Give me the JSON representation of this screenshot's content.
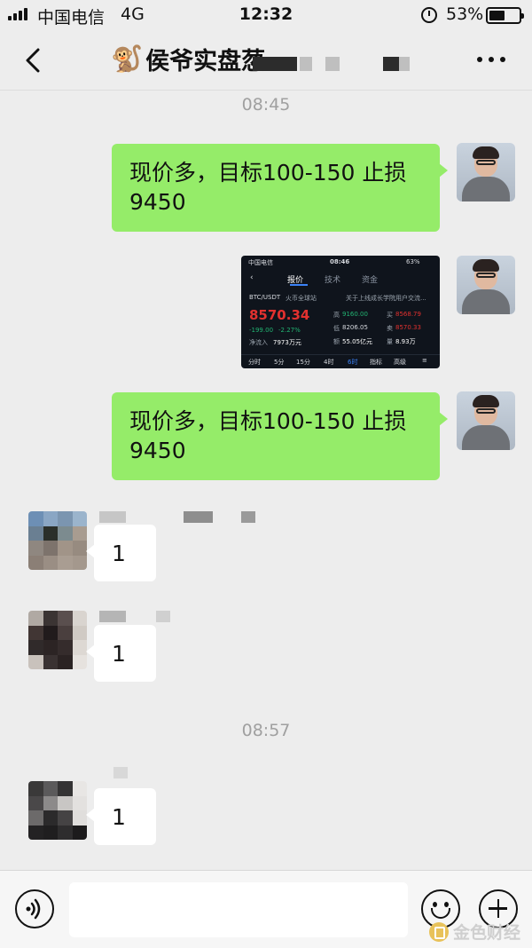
{
  "status_bar": {
    "carrier": "中国电信",
    "network": "4G",
    "time": "12:32",
    "battery": "53%",
    "battery_level": 0.53
  },
  "header": {
    "title": "侯爷实盘䓤",
    "title_icon": "monkey-emoji",
    "back_icon": "chevron-left-icon",
    "more_icon": "ellipsis-icon"
  },
  "messages": [
    {
      "type": "time",
      "text": "08:45"
    },
    {
      "type": "outgoing-text",
      "line1": "现价多，目标100-150 止损",
      "line2": "9450"
    },
    {
      "type": "outgoing-image",
      "image": {
        "status_carrier": "中国电信",
        "status_time": "08:46",
        "status_battery": "63%",
        "tabs": [
          "报价",
          "技术",
          "资金"
        ],
        "pair": "BTC/USDT",
        "exchange": "火币全球站",
        "notice": "关于上线成长学院用户交流...",
        "price": "8570.34",
        "change": "-199.00",
        "change_pct": "-2.27%",
        "net_inflow_label": "净流入",
        "net_inflow": "7973万元",
        "high_label": "高",
        "high": "9160.00",
        "low_label": "低",
        "low": "8206.05",
        "buy_label": "买",
        "buy": "8568.79",
        "sell_label": "卖",
        "sell": "8570.33",
        "volume_label": "额",
        "volume": "55.05亿元",
        "amount_label": "量",
        "amount": "8.93万",
        "bottom_tabs": [
          "分时",
          "5分",
          "15分",
          "4时",
          "6时",
          "指标",
          "高级"
        ]
      }
    },
    {
      "type": "outgoing-text",
      "line1": "现价多，目标100-150 止损",
      "line2": "9450"
    },
    {
      "type": "incoming-text",
      "text": "1"
    },
    {
      "type": "incoming-text",
      "text": "1"
    },
    {
      "type": "time",
      "text": "08:57"
    },
    {
      "type": "incoming-text",
      "text": "1"
    }
  ],
  "input_bar": {
    "voice_icon": "voice-icon",
    "placeholder": "",
    "emoji_icon": "emoji-icon",
    "plus_icon": "plus-icon"
  },
  "watermark": {
    "text": "金色财经"
  }
}
